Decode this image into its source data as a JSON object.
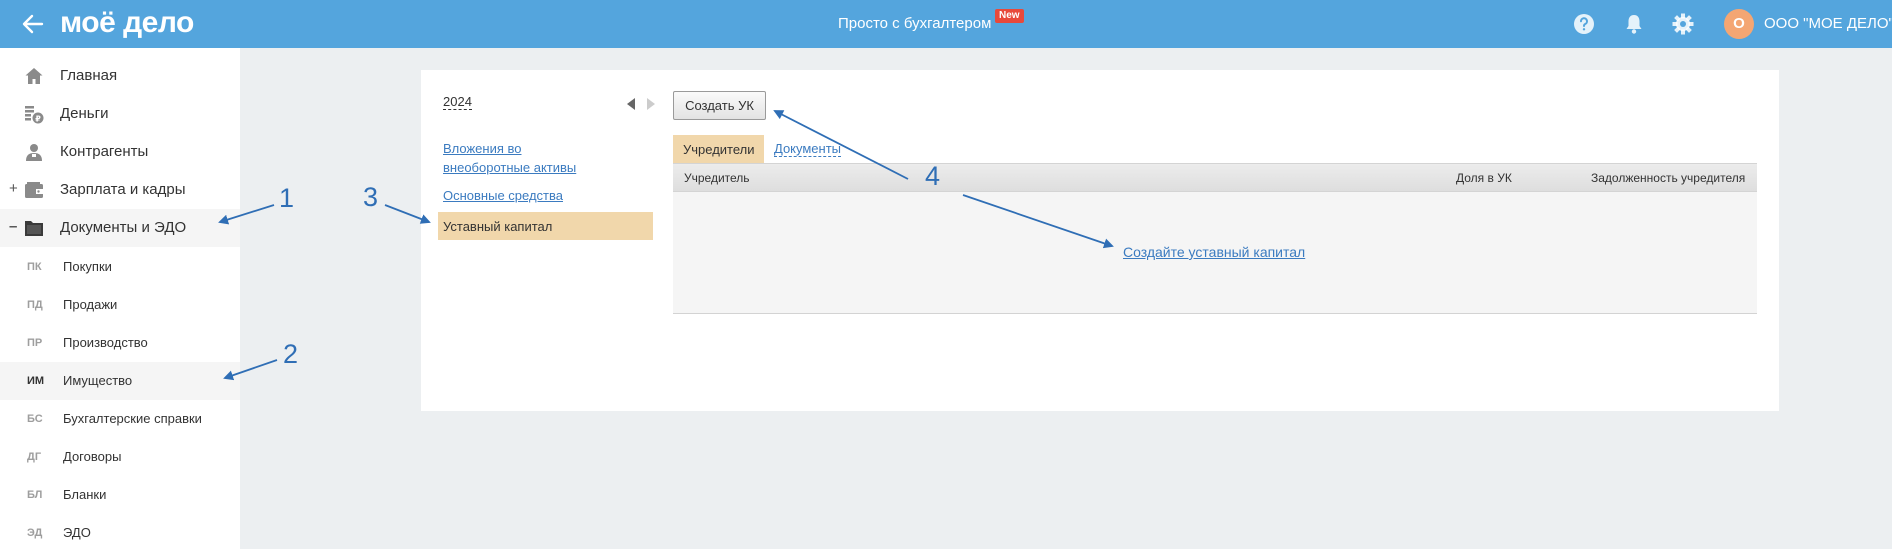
{
  "header": {
    "logo": "моё дело",
    "promo": "Просто с бухгалтером",
    "new_badge": "New",
    "avatar_letter": "О",
    "org_name": "ООО \"МОЕ ДЕЛО\"",
    "icons": [
      "back-arrow-icon",
      "help-icon",
      "bell-icon",
      "gear-icon"
    ]
  },
  "sidebar": {
    "items": [
      {
        "label": "Главная",
        "icon": "home-icon"
      },
      {
        "label": "Деньги",
        "icon": "money-icon"
      },
      {
        "label": "Контрагенты",
        "icon": "contractors-icon"
      },
      {
        "label": "Зарплата и кадры",
        "icon": "wallet-icon",
        "toggle": "+"
      },
      {
        "label": "Документы и ЭДО",
        "icon": "folder-icon",
        "toggle": "–"
      }
    ],
    "subitems": [
      {
        "abbr": "ПК",
        "label": "Покупки"
      },
      {
        "abbr": "ПД",
        "label": "Продажи"
      },
      {
        "abbr": "ПР",
        "label": "Производство"
      },
      {
        "abbr": "ИМ",
        "label": "Имущество"
      },
      {
        "abbr": "БС",
        "label": "Бухгалтерские справки"
      },
      {
        "abbr": "ДГ",
        "label": "Договоры"
      },
      {
        "abbr": "БЛ",
        "label": "Бланки"
      },
      {
        "abbr": "ЭД",
        "label": "ЭДО"
      }
    ]
  },
  "content": {
    "year": "2024",
    "sections": [
      {
        "label_line1": "Вложения во",
        "label_line2": "внеоборотные активы"
      },
      {
        "label": "Основные средства"
      },
      {
        "label": "Уставный капитал"
      }
    ],
    "create_button": "Создать УК",
    "tabs": [
      {
        "label": "Учредители"
      },
      {
        "label": "Документы"
      }
    ],
    "table": {
      "columns": [
        "Учредитель",
        "Доля в УК",
        "Задолженность учредителя"
      ],
      "empty_link": "Создайте уставный капитал"
    }
  },
  "annotations": [
    "1",
    "2",
    "3",
    "4"
  ],
  "colors": {
    "header_bg": "#54a5dd",
    "active_bg": "#f1d7ab",
    "link": "#3b7bc0",
    "annotation": "#2f6eb5",
    "avatar": "#f4a673",
    "badge": "#e8493b"
  }
}
